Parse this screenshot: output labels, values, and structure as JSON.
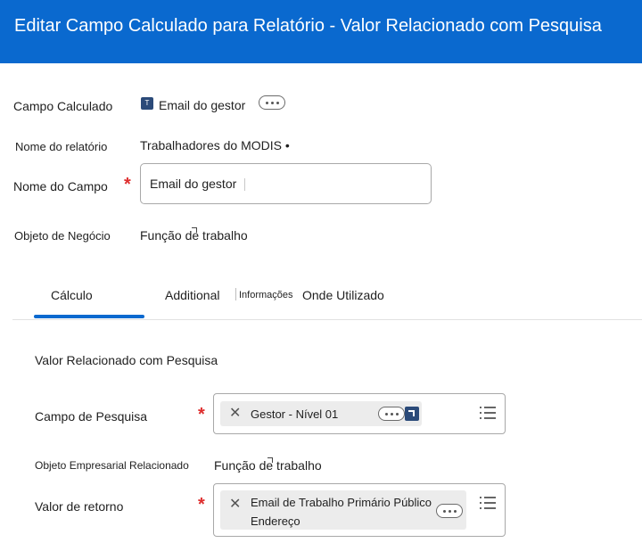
{
  "header": {
    "title": "Editar Campo Calculado para Relatório - Valor Relacionado com Pesquisa"
  },
  "fields": {
    "calculated_field": {
      "label": "Campo Calculado",
      "value": "Email do gestor",
      "type_badge": "T"
    },
    "report_name": {
      "label": "Nome do relatório",
      "value": "Trabalhadores do MODIS •"
    },
    "field_name": {
      "label": "Nome do Campo",
      "value": "Email do gestor"
    },
    "business_object": {
      "label": "Objeto de Negócio",
      "value": "Função de trabalho"
    }
  },
  "tabs": [
    {
      "label": "Cálculo",
      "active": true
    },
    {
      "label": "Additional"
    },
    {
      "label": "Informações"
    },
    {
      "label": "Onde Utilizado"
    }
  ],
  "section": {
    "title": "Valor Relacionado com Pesquisa",
    "lookup_field": {
      "label": "Campo de Pesquisa",
      "value": "Gestor - Nível 01"
    },
    "related_object": {
      "label": "Objeto Empresarial Relacionado",
      "value": "Função de trabalho"
    },
    "return_value": {
      "label": "Valor de retorno",
      "value_line1": "Email de Trabalho Primário Público",
      "value_line2": "Endereço"
    }
  },
  "icons": {
    "related_actions": "ellipsis-icon",
    "remove": "close-icon",
    "prompt": "list-icon",
    "navigate": "external-link-icon"
  },
  "colors": {
    "header": "#0a69cf",
    "required": "#de2d2d",
    "tab_active": "#0a69cf",
    "badge": "#2b4a79"
  }
}
